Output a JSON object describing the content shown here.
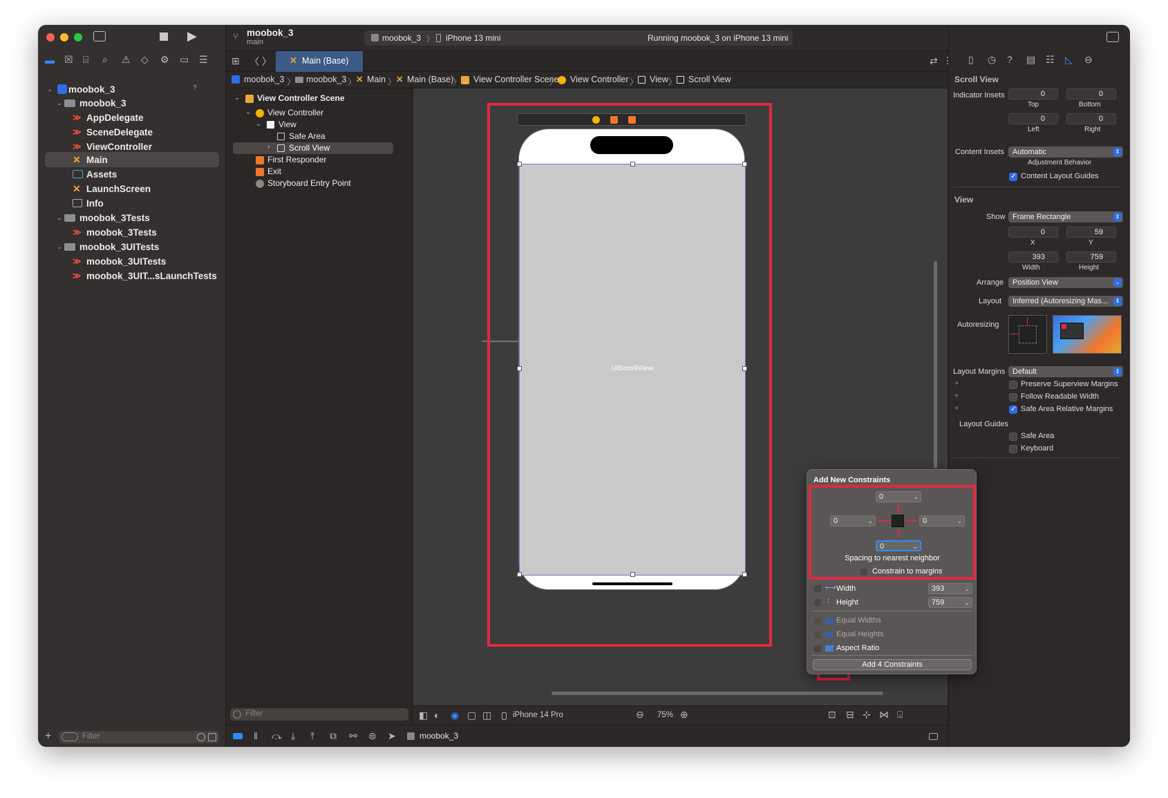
{
  "window": {
    "title": "moobok_3",
    "branch": "main"
  },
  "scheme": {
    "target": "moobok_3",
    "device": "iPhone 13 mini",
    "status": "Running moobok_3 on iPhone 13 mini"
  },
  "tab": {
    "label": "Main (Base)"
  },
  "breadcrumb": [
    "moobok_3",
    "moobok_3",
    "Main",
    "Main (Base)",
    "View Controller Scene",
    "View Controller",
    "View",
    "Scroll View"
  ],
  "navigator": {
    "items": [
      {
        "label": "moobok_3",
        "kind": "project",
        "badge": "?"
      },
      {
        "label": "moobok_3",
        "kind": "folder"
      },
      {
        "label": "AppDelegate",
        "kind": "swift"
      },
      {
        "label": "SceneDelegate",
        "kind": "swift"
      },
      {
        "label": "ViewController",
        "kind": "swift"
      },
      {
        "label": "Main",
        "kind": "storyboard"
      },
      {
        "label": "Assets",
        "kind": "assets"
      },
      {
        "label": "LaunchScreen",
        "kind": "storyboard"
      },
      {
        "label": "Info",
        "kind": "plist"
      },
      {
        "label": "moobok_3Tests",
        "kind": "folder"
      },
      {
        "label": "moobok_3Tests",
        "kind": "swift"
      },
      {
        "label": "moobok_3UITests",
        "kind": "folder"
      },
      {
        "label": "moobok_3UITests",
        "kind": "swift"
      },
      {
        "label": "moobok_3UIT...sLaunchTests",
        "kind": "swift"
      }
    ],
    "filter_placeholder": "Filter"
  },
  "outline": {
    "items": [
      "View Controller Scene",
      "View Controller",
      "View",
      "Safe Area",
      "Scroll View",
      "First Responder",
      "Exit",
      "Storyboard Entry Point"
    ],
    "filter_placeholder": "Filter"
  },
  "canvas": {
    "scrollview_label": "UIScrollView",
    "device": "iPhone 14 Pro",
    "zoom": "75%"
  },
  "debug": {
    "target": "moobok_3"
  },
  "inspector": {
    "scroll_view_title": "Scroll View",
    "indicator_insets_label": "Indicator Insets",
    "insets": {
      "top": "0",
      "bottom": "0",
      "left": "0",
      "right": "0"
    },
    "inset_labels": {
      "top": "Top",
      "bottom": "Bottom",
      "left": "Left",
      "right": "Right"
    },
    "content_insets_label": "Content Insets",
    "content_insets_value": "Automatic",
    "adjustment_behavior": "Adjustment Behavior",
    "content_layout_guides": "Content Layout Guides",
    "view_title": "View",
    "show_label": "Show",
    "show_value": "Frame Rectangle",
    "x": "0",
    "y": "59",
    "width": "393",
    "height": "759",
    "xy_labels": {
      "x": "X",
      "y": "Y",
      "width": "Width",
      "height": "Height"
    },
    "arrange_label": "Arrange",
    "arrange_value": "Position View",
    "layout_label": "Layout",
    "layout_value": "Inferred (Autoresizing Mas...",
    "autoresizing_label": "Autoresizing",
    "layout_margins_label": "Layout Margins",
    "layout_margins_value": "Default",
    "preserve": "Preserve Superview Margins",
    "follow": "Follow Readable Width",
    "safe_area_relative": "Safe Area Relative Margins",
    "layout_guides_label": "Layout Guides",
    "safe_area": "Safe Area",
    "keyboard": "Keyboard"
  },
  "popover": {
    "title": "Add New Constraints",
    "top": "0",
    "left": "0",
    "right": "0",
    "bottom": "0",
    "spacing_label": "Spacing to nearest neighbor",
    "constrain_margins": "Constrain to margins",
    "width_label": "Width",
    "width_value": "393",
    "height_label": "Height",
    "height_value": "759",
    "equal_widths": "Equal Widths",
    "equal_heights": "Equal Heights",
    "aspect_ratio": "Aspect Ratio",
    "add_button": "Add 4 Constraints"
  },
  "colors": {
    "highlight_red": "#e0293f",
    "accent_blue": "#2d6ee6",
    "scrollview_gray": "#c9c9c9"
  }
}
